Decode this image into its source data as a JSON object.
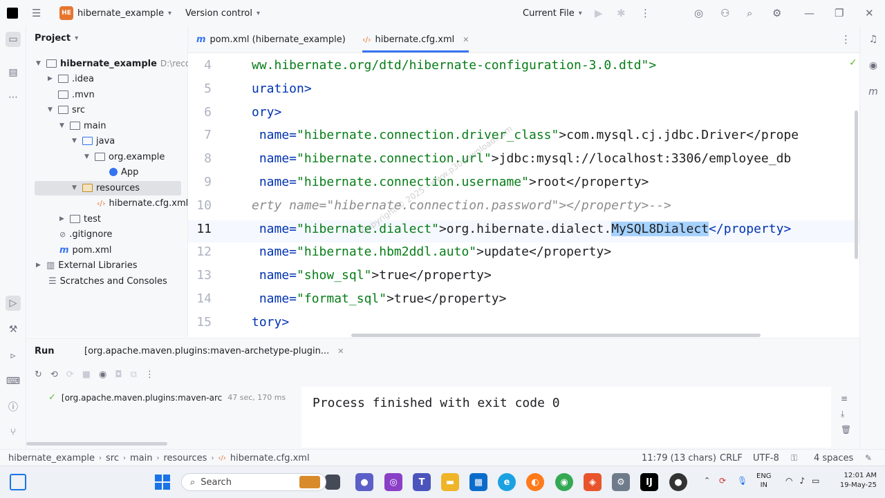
{
  "titlebar": {
    "project_badge": "HE",
    "project_name": "hibernate_example",
    "version_control": "Version control",
    "run_config": "Current File"
  },
  "project_panel": {
    "title": "Project",
    "root": {
      "name": "hibernate_example",
      "path": "D:\\recordi"
    },
    "items": [
      {
        "label": ".idea"
      },
      {
        "label": ".mvn"
      },
      {
        "label": "src"
      },
      {
        "label": "main"
      },
      {
        "label": "java"
      },
      {
        "label": "org.example"
      },
      {
        "label": "App"
      },
      {
        "label": "resources"
      },
      {
        "label": "hibernate.cfg.xml"
      },
      {
        "label": "test"
      },
      {
        "label": ".gitignore"
      },
      {
        "label": "pom.xml"
      },
      {
        "label": "External Libraries"
      },
      {
        "label": "Scratches and Consoles"
      }
    ]
  },
  "tabs": [
    {
      "label": "pom.xml (hibernate_example)"
    },
    {
      "label": "hibernate.cfg.xml"
    }
  ],
  "editor": {
    "line_numbers": [
      "4",
      "5",
      "6",
      "7",
      "8",
      "9",
      "10",
      "11",
      "12",
      "13",
      "14",
      "15"
    ],
    "lines": {
      "l4": "ww.hibernate.org/dtd/hibernate-configuration-3.0.dtd\">",
      "l5": "uration>",
      "l6": "ory>",
      "l7a": " name=",
      "l7b": "\"hibernate.connection.driver_class\"",
      "l7c": ">com.mysql.cj.jdbc.Driver</prope",
      "l8a": " name=",
      "l8b": "\"hibernate.connection.url\"",
      "l8c": ">jdbc:mysql://localhost:3306/employee_db",
      "l9a": " name=",
      "l9b": "\"hibernate.connection.username\"",
      "l9c": ">root</property>",
      "l10": "erty name=\"hibernate.connection.password\"></property>-->",
      "l11a": " name=",
      "l11b": "\"hibernate.dialect\"",
      "l11c": ">org.hibernate.dialect.",
      "l11d": "MySQL8Dialect",
      "l11e": "</property>",
      "l12a": " name=",
      "l12b": "\"hibernate.hbm2ddl.auto\"",
      "l12c": ">update</property>",
      "l13a": " name=",
      "l13b": "\"show_sql\"",
      "l13c": ">true</property>",
      "l14a": " name=",
      "l14b": "\"format_sql\"",
      "l14c": ">true</property>",
      "l15": "tory>"
    }
  },
  "run_panel": {
    "tab": "Run",
    "config": "[org.apache.maven.plugins:maven-archetype-plugin...",
    "tree_item": "[org.apache.maven.plugins:maven-arc",
    "tree_time": "47 sec, 170 ms",
    "output": "Process finished with exit code 0"
  },
  "statusbar": {
    "breadcrumb": [
      "hibernate_example",
      "src",
      "main",
      "resources",
      "hibernate.cfg.xml"
    ],
    "position": "11:79 (13 chars)",
    "line_sep": "CRLF",
    "encoding": "UTF-8",
    "indent": "4 spaces"
  },
  "taskbar": {
    "search_placeholder": "Search",
    "lang": "ENG",
    "region": "IN",
    "time": "12:01 AM",
    "date": "19-May-25"
  },
  "watermark": "Copyright © 2025 - www.p30download.com"
}
